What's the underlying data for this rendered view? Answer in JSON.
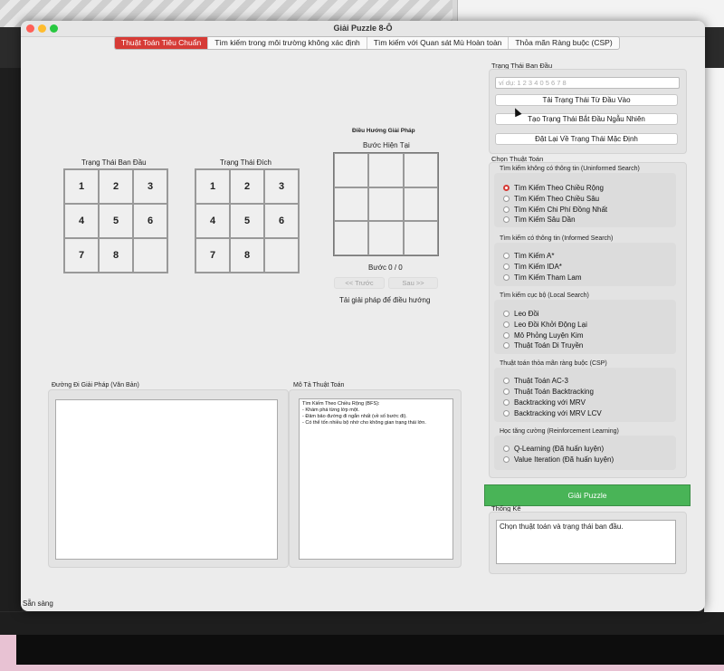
{
  "window": {
    "title": "Giải Puzzle 8-Ô"
  },
  "tabs": [
    {
      "label": "Thuật Toán Tiêu Chuẩn",
      "active": true
    },
    {
      "label": "Tìm kiếm trong môi trường không xác định"
    },
    {
      "label": "Tìm kiếm với Quan sát Mù Hoàn toàn"
    },
    {
      "label": "Thỏa mãn Ràng buộc (CSP)"
    }
  ],
  "boards": {
    "initial_label": "Trạng Thái Ban Đầu",
    "goal_label": "Trạng Thái Đích",
    "initial": [
      "1",
      "2",
      "3",
      "4",
      "5",
      "6",
      "7",
      "8",
      ""
    ],
    "goal": [
      "1",
      "2",
      "3",
      "4",
      "5",
      "6",
      "7",
      "8",
      ""
    ]
  },
  "navigation": {
    "title": "Điều Hướng Giải Pháp",
    "current_step_label": "Bước Hiện Tại",
    "step_counter": "Bước 0 / 0",
    "prev_button": "<< Trước",
    "next_button": "Sau >>",
    "hint": "Tải giải pháp để điều hướng"
  },
  "solution_path": {
    "label": "Đường Đi Giải Pháp (Văn Bản)",
    "text": ""
  },
  "algorithm_desc": {
    "label": "Mô Tả Thuật Toán",
    "text": "Tìm Kiếm Theo Chiều Rộng (BFS):\n- Khám phá từng lớp một.\n- Đảm bảo đường đi ngắn nhất (về số bước đi).\n- Có thể tốn nhiều bộ nhớ cho không gian trạng thái lớn."
  },
  "initial_state": {
    "section_label": "Trạng Thái Ban Đầu",
    "input_placeholder": "ví dụ: 1 2 3 4 0 5 6 7 8",
    "load_button": "Tải Trạng Thái Từ Đầu Vào",
    "random_button": "Tạo Trạng Thái Bắt Đầu Ngẫu Nhiên",
    "reset_button": "Đặt Lại Về Trạng Thái Mặc Định"
  },
  "algorithms": {
    "section_label": "Chọn Thuật Toán",
    "groups": [
      {
        "title": "Tìm kiếm không có thông tin (Uninformed Search)",
        "options": [
          "Tìm Kiếm Theo Chiều Rộng",
          "Tìm Kiếm Theo Chiều Sâu",
          "Tìm Kiếm Chi Phí Đồng Nhất",
          "Tìm Kiếm Sâu Dần"
        ]
      },
      {
        "title": "Tìm kiếm có thông tin (Informed Search)",
        "options": [
          "Tìm Kiếm A*",
          "Tìm Kiếm IDA*",
          "Tìm Kiếm Tham Lam"
        ]
      },
      {
        "title": "Tìm kiếm cục bộ (Local Search)",
        "options": [
          "Leo Đồi",
          "Leo Đồi Khởi Động Lại",
          "Mô Phỏng Luyện Kim",
          "Thuật Toán Di Truyền"
        ]
      },
      {
        "title": "Thuật toán thỏa mãn ràng buộc (CSP)",
        "options": [
          "Thuật Toán AC-3",
          "Thuật Toán Backtracking",
          "Backtracking với MRV",
          "Backtracking với MRV  LCV"
        ]
      },
      {
        "title": "Học tăng cường (Reinforcement Learning)",
        "options": [
          "Q-Learning (Đã huấn luyện)",
          "Value Iteration (Đã huấn luyện)"
        ]
      }
    ],
    "selected": "Tìm Kiếm Theo Chiều Rộng"
  },
  "solve_button": "Giải Puzzle",
  "stats": {
    "label": "Thống Kê",
    "text": "Chọn thuật toán và trạng thái ban đầu."
  },
  "status_bar": "Sẵn sàng",
  "colors": {
    "accent": "#d63b36",
    "solve": "#49b457"
  }
}
